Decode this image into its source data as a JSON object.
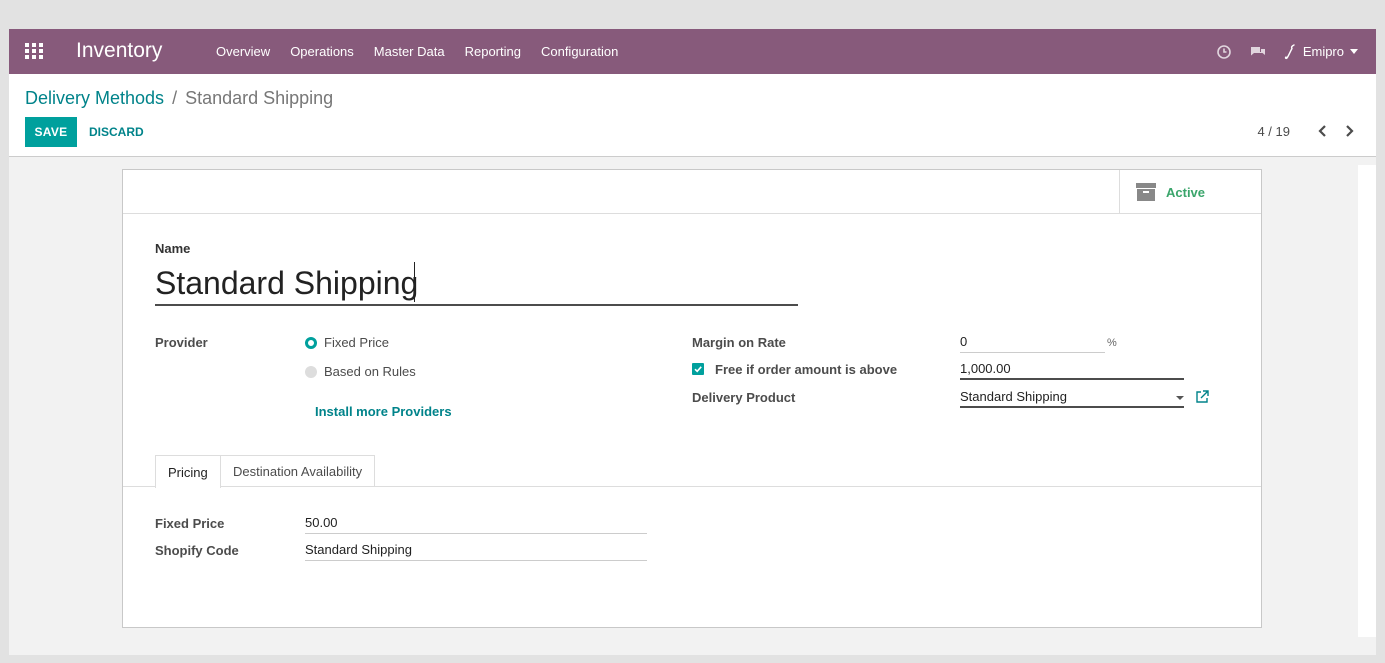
{
  "navbar": {
    "app_name": "Inventory",
    "menu": [
      "Overview",
      "Operations",
      "Master Data",
      "Reporting",
      "Configuration"
    ],
    "user": "Emipro",
    "icons": [
      "apps-grid-icon",
      "clock-icon",
      "chat-icon",
      "phone-icon"
    ]
  },
  "breadcrumb": {
    "parent": "Delivery Methods",
    "separator": "/",
    "current": "Standard Shipping"
  },
  "actions": {
    "save": "SAVE",
    "discard": "DISCARD"
  },
  "pager": {
    "value": "4 / 19"
  },
  "status_button": {
    "label": "Active",
    "icon": "archive-icon"
  },
  "form": {
    "name_label": "Name",
    "name_value": "Standard Shipping",
    "provider_label": "Provider",
    "provider_options": [
      "Fixed Price",
      "Based on Rules"
    ],
    "provider_selected": "Fixed Price",
    "install_link": "Install more Providers",
    "margin_label": "Margin on Rate",
    "margin_value": "0",
    "margin_unit": "%",
    "free_label": "Free if order amount is above",
    "free_checked": true,
    "free_amount": "1,000.00",
    "delivery_product_label": "Delivery Product",
    "delivery_product_value": "Standard Shipping"
  },
  "tabs": {
    "items": [
      "Pricing",
      "Destination Availability"
    ],
    "active": "Pricing"
  },
  "pricing": {
    "fixed_price_label": "Fixed Price",
    "fixed_price_value": "50.00",
    "shopify_code_label": "Shopify Code",
    "shopify_code_value": "Standard Shipping"
  },
  "colors": {
    "navbar": "#875a7b",
    "primary": "#00a09d",
    "link": "#00838a",
    "active": "#3aa56b"
  }
}
